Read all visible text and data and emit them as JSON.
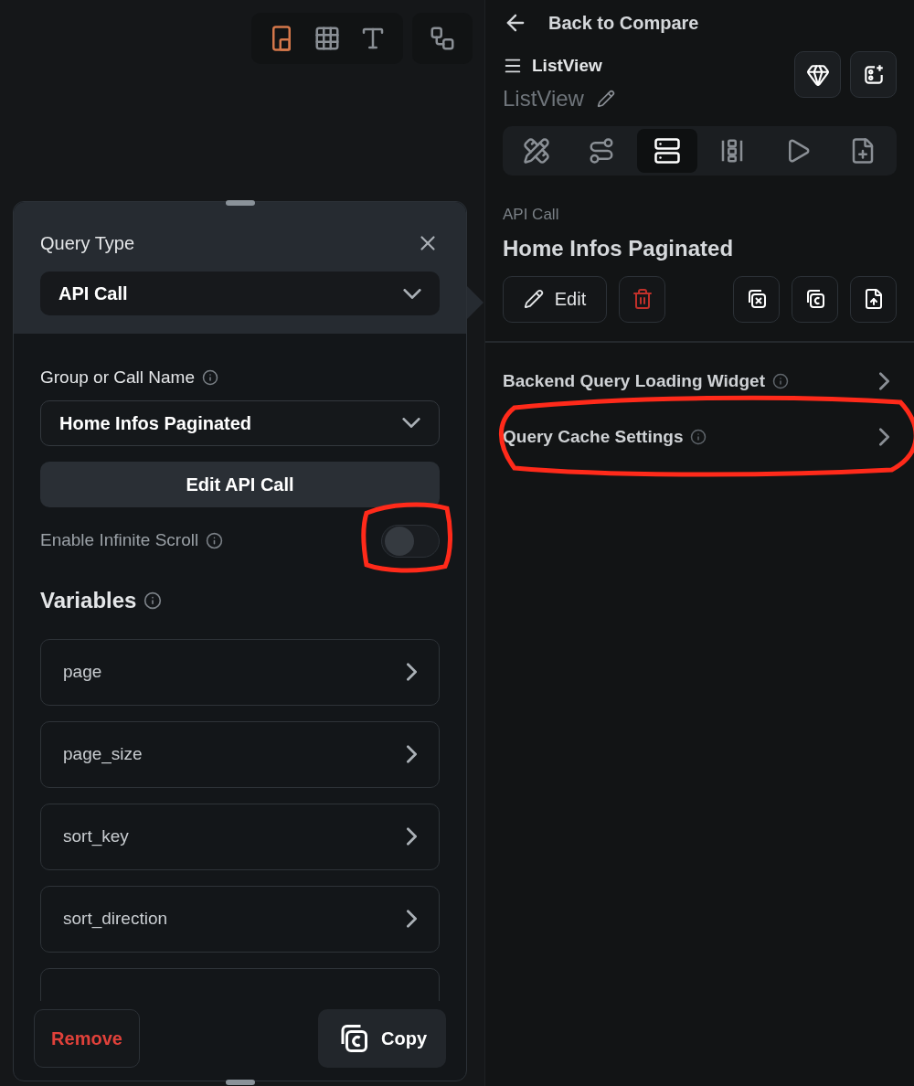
{
  "canvas_toolbar": {
    "groups": [
      [
        {
          "kind": "device",
          "selected": true
        },
        {
          "kind": "grid",
          "selected": false
        },
        {
          "kind": "text",
          "selected": false
        }
      ],
      [
        {
          "kind": "graph",
          "selected": false
        }
      ]
    ]
  },
  "query_panel": {
    "title": "Query Type",
    "query_type": "API Call",
    "call_name_label": "Group or Call Name",
    "call_name": "Home Infos Paginated",
    "edit_button": "Edit API Call",
    "infinite_scroll": {
      "label": "Enable Infinite Scroll",
      "on": false,
      "highlighted": true
    },
    "variables_title": "Variables",
    "variables": [
      "page",
      "page_size",
      "sort_key",
      "sort_direction"
    ],
    "variables_cut_off": true,
    "remove_button": "Remove",
    "copy_button": "Copy"
  },
  "right_panel": {
    "back": "Back to Compare",
    "widget_type": "ListView",
    "widget_name": "ListView",
    "tabs": [
      {
        "kind": "properties",
        "selected": false
      },
      {
        "kind": "actions",
        "selected": false
      },
      {
        "kind": "backend",
        "selected": true
      },
      {
        "kind": "layout",
        "selected": false
      },
      {
        "kind": "animation",
        "selected": false
      },
      {
        "kind": "notes",
        "selected": false
      }
    ],
    "action_kind": "API Call",
    "action_name": "Home Infos Paginated",
    "edit_button": "Edit",
    "sections": [
      {
        "label": "Backend Query Loading Widget",
        "highlighted": false
      },
      {
        "label": "Query Cache Settings",
        "highlighted": true
      }
    ]
  }
}
